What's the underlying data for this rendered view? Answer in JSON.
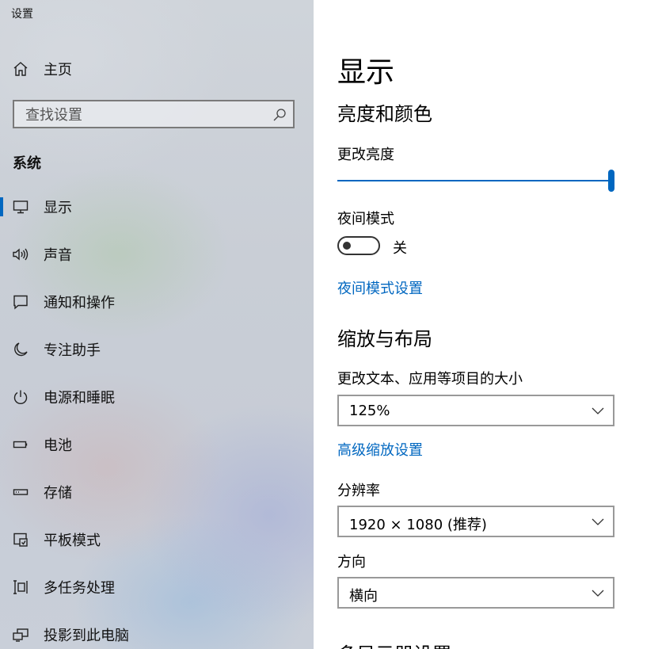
{
  "window": {
    "title": "设置"
  },
  "sidebar": {
    "home_label": "主页",
    "search_placeholder": "查找设置",
    "section_heading": "系统",
    "items": [
      {
        "label": "显示",
        "icon": "monitor-icon",
        "selected": true
      },
      {
        "label": "声音",
        "icon": "speaker-icon",
        "selected": false
      },
      {
        "label": "通知和操作",
        "icon": "notification-icon",
        "selected": false
      },
      {
        "label": "专注助手",
        "icon": "moon-icon",
        "selected": false
      },
      {
        "label": "电源和睡眠",
        "icon": "power-icon",
        "selected": false
      },
      {
        "label": "电池",
        "icon": "battery-icon",
        "selected": false
      },
      {
        "label": "存储",
        "icon": "storage-icon",
        "selected": false
      },
      {
        "label": "平板模式",
        "icon": "tablet-mode-icon",
        "selected": false
      },
      {
        "label": "多任务处理",
        "icon": "multitasking-icon",
        "selected": false
      },
      {
        "label": "投影到此电脑",
        "icon": "project-icon",
        "selected": false
      }
    ]
  },
  "main": {
    "page_title": "显示",
    "brightness_section": {
      "heading": "亮度和颜色",
      "brightness_label": "更改亮度",
      "brightness_level": 1.0,
      "night_mode_label": "夜间模式",
      "night_mode_on": false,
      "night_mode_state_text": "关",
      "night_mode_settings_link": "夜间模式设置"
    },
    "scale_section": {
      "heading": "缩放与布局",
      "scale_label": "更改文本、应用等项目的大小",
      "scale_value": "125%",
      "advanced_scaling_link": "高级缩放设置",
      "resolution_label": "分辨率",
      "resolution_value": "1920 × 1080 (推荐)",
      "orientation_label": "方向",
      "orientation_value": "横向"
    },
    "next_section_heading": "多显示器设置"
  },
  "colors": {
    "accent": "#0067c0",
    "link": "#0067c0"
  }
}
